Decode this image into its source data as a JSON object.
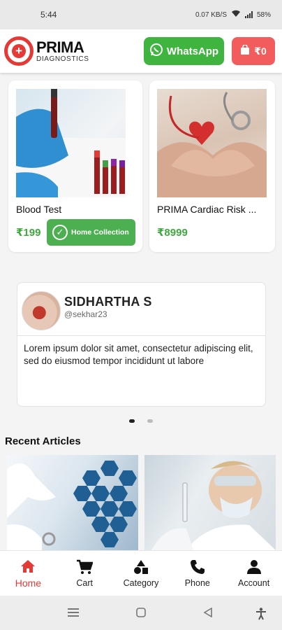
{
  "status_bar": {
    "time": "5:44",
    "indicators": "0.07 KB/S",
    "battery": "58%"
  },
  "header": {
    "brand_name": "PRIMA",
    "brand_sub": "DIAGNOSTICS",
    "whatsapp_label": "WhatsApp",
    "cart_label": "₹0"
  },
  "tests": [
    {
      "title": "Blood Test",
      "price": "₹199",
      "action": "Home Collection"
    },
    {
      "title": "PRIMA Cardiac Risk ...",
      "price": "₹8999"
    }
  ],
  "testimonial": {
    "name": "SIDHARTHA S",
    "handle": "@sekhar23",
    "text": "Lorem ipsum dolor sit amet, consectetur adipiscing elit, sed do eiusmod tempor incididunt ut labore",
    "page_count": 2,
    "active_page": 1
  },
  "articles": {
    "title": "Recent Articles"
  },
  "bottom_nav": [
    {
      "label": "Home",
      "icon": "home-icon",
      "active": true
    },
    {
      "label": "Cart",
      "icon": "cart-icon"
    },
    {
      "label": "Category",
      "icon": "category-icon"
    },
    {
      "label": "Phone",
      "icon": "phone-icon"
    },
    {
      "label": "Account",
      "icon": "account-icon"
    }
  ],
  "colors": {
    "accent_red": "#e53935",
    "whatsapp_green": "#3fb43f",
    "cart_red": "#f25c5c",
    "price_green": "#3fa83f"
  }
}
